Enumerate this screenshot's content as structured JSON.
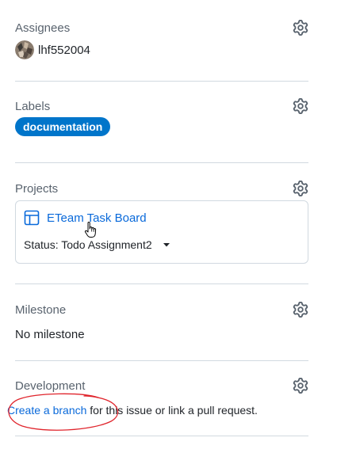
{
  "assignees": {
    "title": "Assignees",
    "user": "lhf552004",
    "settings_icon": "gear-icon"
  },
  "labels": {
    "title": "Labels",
    "items": [
      {
        "name": "documentation",
        "color": "#0075ca"
      }
    ],
    "settings_icon": "gear-icon"
  },
  "projects": {
    "title": "Projects",
    "project_name": "ETeam Task Board",
    "project_icon": "table-icon",
    "status_text": "Status: Todo Assignment2",
    "dropdown_icon": "triangle-down-icon",
    "settings_icon": "gear-icon"
  },
  "milestone": {
    "title": "Milestone",
    "value": "No milestone",
    "settings_icon": "gear-icon"
  },
  "development": {
    "title": "Development",
    "link_text": "Create a branch",
    "rest_text": " for this issue or link a pull request.",
    "settings_icon": "gear-icon"
  },
  "colors": {
    "link": "#0969da",
    "label_bg": "#0075ca",
    "muted": "#59636e",
    "border": "#d1d9e0",
    "annotation": "#e0242c"
  }
}
